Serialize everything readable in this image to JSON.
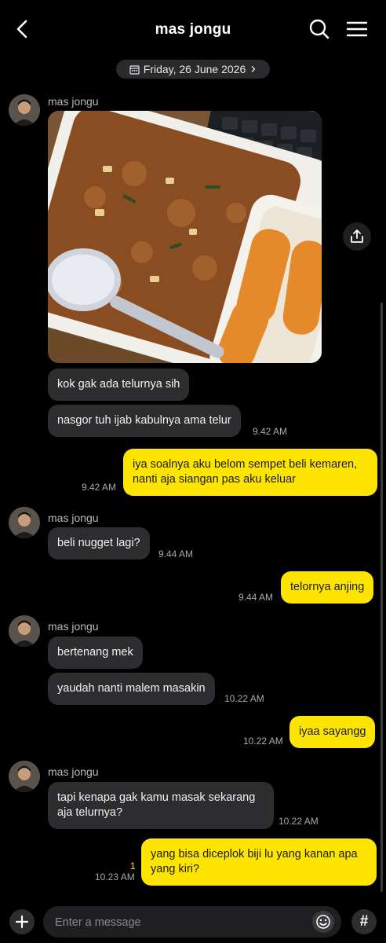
{
  "header": {
    "title": "mas jongu",
    "back_icon": "back-arrow-icon",
    "search_icon": "search-icon",
    "menu_icon": "menu-icon"
  },
  "date_separator": {
    "label": "Friday, 26 June 2026",
    "icon": "calendar-icon",
    "chevron": "chevron-right-icon"
  },
  "messages": [
    {
      "sender": "mas jongu",
      "photo": "food-photo",
      "text": "kok gak ada telurnya sih"
    },
    {
      "text": "nasgor tuh ijab kabulnya ama telur",
      "time": "9.42 AM"
    },
    {
      "out_text_1": "iya soalnya aku belom sempet beli kemaren,",
      "out_text_2": "nanti aja siangan pas aku keluar",
      "time": "9.42 AM"
    },
    {
      "sender": "mas jongu",
      "text": "beli nugget lagi?",
      "time": "9.44 AM"
    },
    {
      "out_text": "telornya anjing",
      "time": "9.44 AM"
    },
    {
      "sender": "mas jongu",
      "text": "bertenang mek"
    },
    {
      "text": "yaudah nanti malem masakin",
      "time": "10.22 AM"
    },
    {
      "out_text": "iyaa sayangg",
      "time": "10.22 AM"
    },
    {
      "sender": "mas jongu",
      "text_1": "tapi kenapa gak kamu masak sekarang",
      "text_2": "aja telurnya?",
      "time": "10.22 AM"
    },
    {
      "out_text_1": "yang bisa diceplok biji lu yang kanan apa",
      "out_text_2": "yang kiri?",
      "unread": "1",
      "time": "10.23 AM"
    }
  ],
  "composer": {
    "placeholder": "Enter a message",
    "plus_icon": "plus-icon",
    "emoji_icon": "emoji-icon",
    "hash_label": "#"
  },
  "colors": {
    "background": "#000000",
    "incoming_bubble": "#2d2d30",
    "outgoing_bubble": "#fee500"
  }
}
